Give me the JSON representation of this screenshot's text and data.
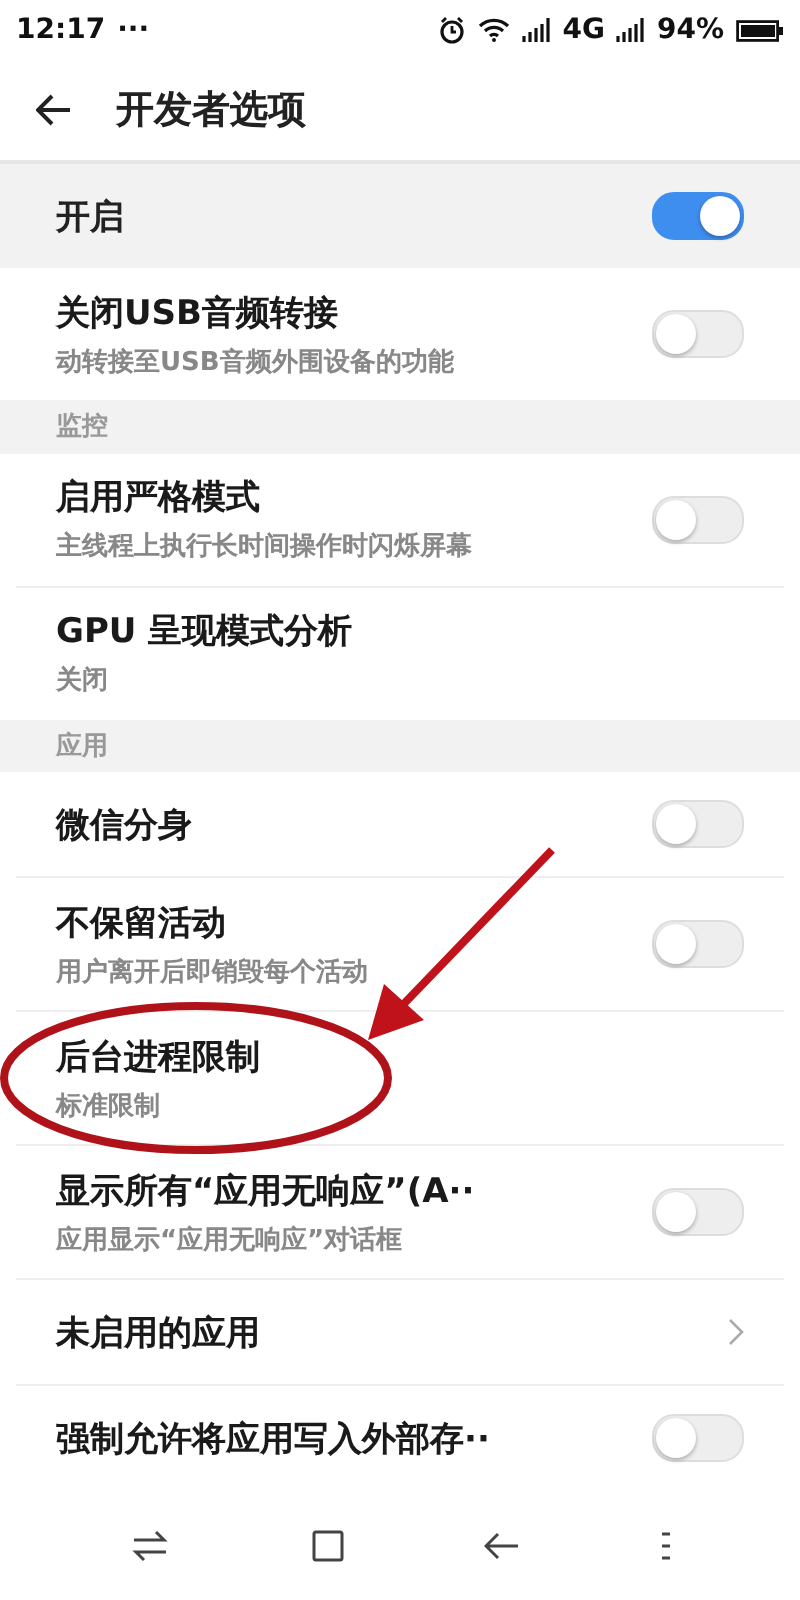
{
  "status_bar": {
    "time": "12:17",
    "dots": "···",
    "network": "4G",
    "battery": "94%"
  },
  "header": {
    "title": "开发者选项"
  },
  "master": {
    "label": "开启",
    "on": true
  },
  "rows": [
    {
      "kind": "toggle",
      "title": "关闭USB音频转接",
      "subtitle": "动转接至USB音频外围设备的功能",
      "on": false
    },
    {
      "kind": "section",
      "title": "监控"
    },
    {
      "kind": "toggle",
      "title": "启用严格模式",
      "subtitle": "主线程上执行长时间操作时闪烁屏幕",
      "on": false
    },
    {
      "kind": "plain",
      "title": "GPU 呈现模式分析",
      "subtitle": "关闭"
    },
    {
      "kind": "section",
      "title": "应用"
    },
    {
      "kind": "toggle",
      "title": "微信分身",
      "on": false
    },
    {
      "kind": "toggle",
      "title": "不保留活动",
      "subtitle": "用户离开后即销毁每个活动",
      "on": false
    },
    {
      "kind": "plain",
      "title": "后台进程限制",
      "subtitle": "标准限制",
      "circled": true
    },
    {
      "kind": "toggle",
      "title": "显示所有“应用无响应”(A··",
      "subtitle": "应用显示“应用无响应”对话框",
      "on": false
    },
    {
      "kind": "link",
      "title": "未启用的应用"
    },
    {
      "kind": "toggle",
      "title": "强制允许将应用写入外部存··",
      "on": false
    }
  ]
}
